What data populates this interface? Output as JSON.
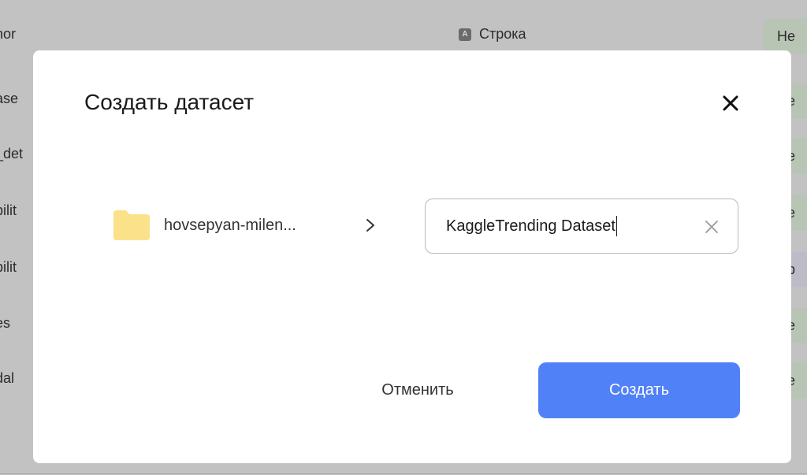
{
  "background": {
    "rows": [
      "hor",
      "ase",
      "_det",
      "bilit",
      "bilit",
      "es",
      "dal"
    ],
    "type_badge": "A",
    "type_label": "Строка",
    "pills": [
      "Не",
      "Не",
      "Не",
      "Не",
      "Пр",
      "Не",
      "Не"
    ]
  },
  "modal": {
    "title": "Создать датасет",
    "folder_label": "hovsepyan-milen...",
    "input_value": "KaggleTrending Dataset",
    "cancel_label": "Отменить",
    "create_label": "Создать"
  },
  "colors": {
    "primary": "#5181f7",
    "folder": "#fbe18a"
  },
  "icons": [
    "close-icon",
    "folder-icon",
    "chevron-right-icon",
    "clear-icon"
  ]
}
